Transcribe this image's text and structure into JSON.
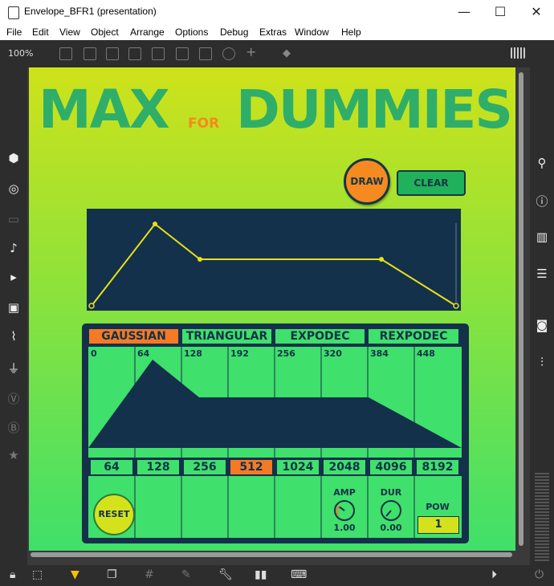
{
  "window": {
    "title": "Envelope_BFR1 (presentation)",
    "minimize": "—",
    "maximize": "☐",
    "close": "✕"
  },
  "menu": [
    "File",
    "Edit",
    "View",
    "Object",
    "Arrange",
    "Options",
    "Debug",
    "Extras",
    "Window",
    "Help"
  ],
  "toolbar": {
    "zoom": "100%"
  },
  "patch": {
    "logo": {
      "max": "MAX",
      "for": "FOR",
      "dummies": "DUMMIES"
    },
    "draw_label": "DRAW",
    "clear_label": "CLEAR",
    "tabs": [
      {
        "label": "GAUSSIAN",
        "active": true
      },
      {
        "label": "TRIANGULAR",
        "active": false
      },
      {
        "label": "EXPODEC",
        "active": false
      },
      {
        "label": "REXPODEC",
        "active": false
      }
    ],
    "indices": [
      "0",
      "64",
      "128",
      "192",
      "256",
      "320",
      "384",
      "448"
    ],
    "sizes": [
      {
        "label": "64",
        "active": false
      },
      {
        "label": "128",
        "active": false
      },
      {
        "label": "256",
        "active": false
      },
      {
        "label": "512",
        "active": true
      },
      {
        "label": "1024",
        "active": false
      },
      {
        "label": "2048",
        "active": false
      },
      {
        "label": "4096",
        "active": false
      },
      {
        "label": "8192",
        "active": false
      }
    ],
    "reset_label": "RESET",
    "amp": {
      "label": "AMP",
      "value": "1.00"
    },
    "dur": {
      "label": "DUR",
      "value": "0.00"
    },
    "pow": {
      "label": "POW",
      "value": "1"
    },
    "colors": {
      "accent_orange": "#f47a25",
      "dark_navy": "#13314a",
      "green": "#3fe06b",
      "logo_green": "#2fae6a",
      "envelope_line": "#e8e01a"
    }
  }
}
